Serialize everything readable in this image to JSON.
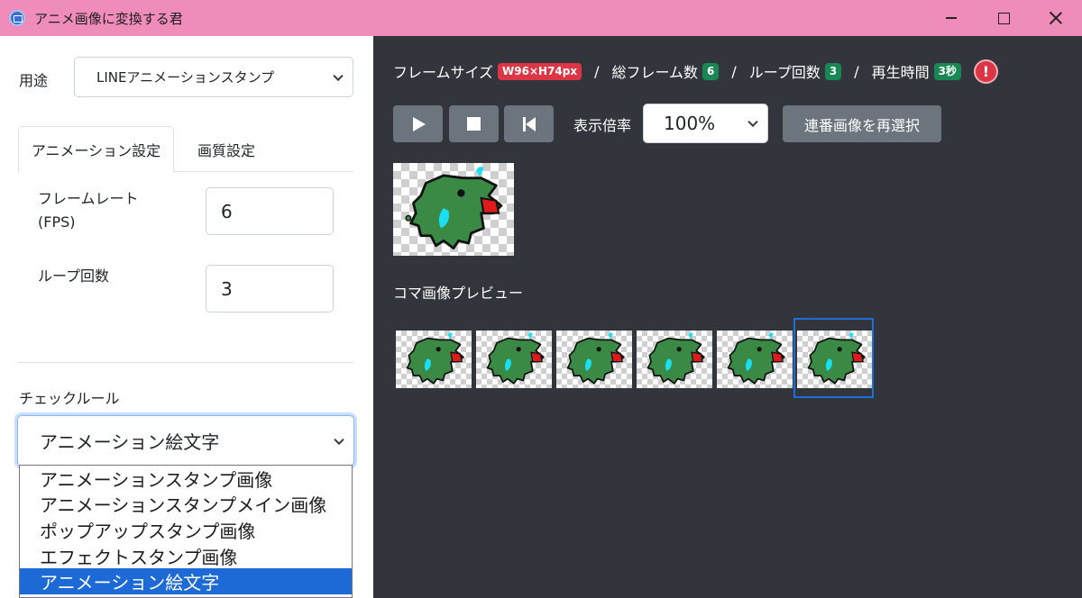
{
  "window": {
    "title": "アニメ画像に変換する君",
    "icon": "app-icon"
  },
  "left": {
    "usage_label": "用途",
    "usage_value": "LINEアニメーションスタンプ",
    "tabs": [
      {
        "label": "アニメーション設定",
        "active": true
      },
      {
        "label": "画質設定",
        "active": false
      }
    ],
    "framerate_label_line1": "フレームレート",
    "framerate_label_line2": "(FPS)",
    "framerate_value": "6",
    "loop_label": "ループ回数",
    "loop_value": "3",
    "check_rule_label": "チェックルール",
    "check_rule_value": "アニメーション絵文字",
    "check_rule_options": [
      "アニメーションスタンプ画像",
      "アニメーションスタンプメイン画像",
      "ポップアップスタンプ画像",
      "エフェクトスタンプ画像",
      "アニメーション絵文字"
    ],
    "check_rule_selected_index": 4
  },
  "right": {
    "info": {
      "frame_size_label": "フレームサイズ",
      "frame_size_badge": "W96×H74px",
      "total_frames_label": "総フレーム数",
      "total_frames_badge": "6",
      "loop_label": "ループ回数",
      "loop_badge": "3",
      "play_time_label": "再生時間",
      "play_time_badge": "3秒",
      "separator": "/",
      "alert_icon": "!"
    },
    "controls": {
      "play_icon": "play-icon",
      "stop_icon": "stop-icon",
      "rewind_icon": "rewind-icon",
      "zoom_label": "表示倍率",
      "zoom_value": "100%",
      "reselect_label": "連番画像を再選択"
    },
    "frame_preview_label": "コマ画像プレビュー",
    "frame_count": 6,
    "selected_frame_index": 5
  },
  "colors": {
    "titlebar": "#f08cba",
    "right_panel": "#32353b",
    "badge_red": "#dc3545",
    "badge_green": "#198754",
    "button_gray": "#6c757d",
    "selected_option": "#1d6ad6",
    "frame_selection": "#1e6fd9",
    "croc_green": "#3a8a45",
    "croc_cyan": "#19e0f0",
    "croc_red": "#e01b1b"
  }
}
